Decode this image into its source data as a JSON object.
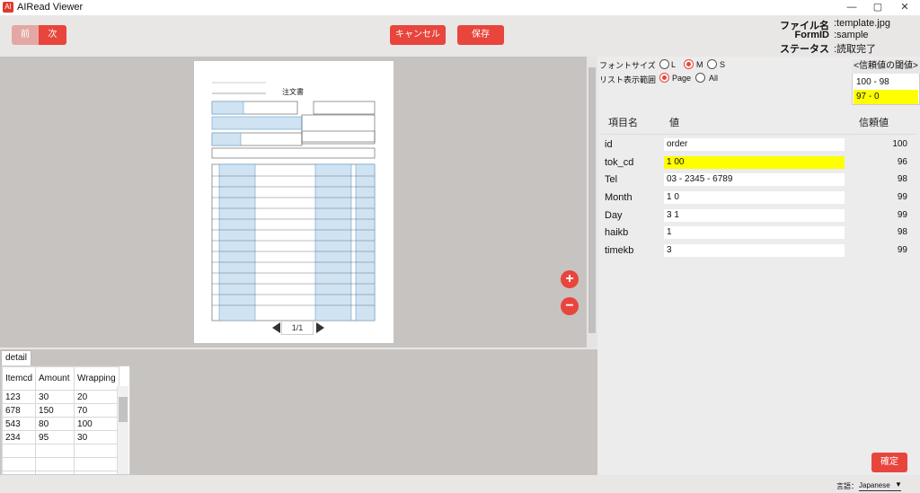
{
  "window": {
    "title": "AIRead Viewer",
    "min": "—",
    "max": "▢",
    "close": "✕"
  },
  "toolbar": {
    "prev": "前",
    "next": "次",
    "cancel": "キャンセル",
    "save": "保存"
  },
  "meta": [
    {
      "label": "ファイル名",
      "value": ":template.jpg"
    },
    {
      "label": "FormID",
      "value": ":sample"
    },
    {
      "label": "ステータス",
      "value": ":読取完了"
    }
  ],
  "document": {
    "title": "注文書"
  },
  "pager": {
    "page": "1/1"
  },
  "zoom": {
    "in": "+",
    "out": "−"
  },
  "detail": {
    "tab": "detail",
    "columns": [
      "Itemcd",
      "Amount",
      "Wrapping"
    ],
    "rows": [
      [
        "123",
        "30",
        "20"
      ],
      [
        "678",
        "150",
        "70"
      ],
      [
        "543",
        "80",
        "100"
      ],
      [
        "234",
        "95",
        "30"
      ],
      [
        "",
        "",
        ""
      ],
      [
        "",
        "",
        ""
      ],
      [
        "",
        "",
        ""
      ]
    ]
  },
  "settings": {
    "font_size_label": "フォントサイズ",
    "font_opts": [
      "L",
      "M",
      "S"
    ],
    "font_selected": "M",
    "range_label": "リスト表示範囲",
    "range_opts": [
      "Page",
      "All"
    ],
    "range_selected": "Page"
  },
  "confidence": {
    "header": "<信頼値の閾値>",
    "ranges": [
      "100 - 98",
      "97 - 0"
    ],
    "highlight_color": "#ffff00"
  },
  "fields": {
    "col_name": "項目名",
    "col_value": "値",
    "col_conf": "信頼値",
    "rows": [
      {
        "name": "id",
        "value": "order",
        "conf": "100",
        "hl": false
      },
      {
        "name": "tok_cd",
        "value": "1 00",
        "conf": "96",
        "hl": true
      },
      {
        "name": "Tel",
        "value": "03 - 2345 - 6789",
        "conf": "98",
        "hl": false
      },
      {
        "name": "Month",
        "value": "1 0",
        "conf": "99",
        "hl": false
      },
      {
        "name": "Day",
        "value": "3 1",
        "conf": "99",
        "hl": false
      },
      {
        "name": "haikb",
        "value": "1",
        "conf": "98",
        "hl": false
      },
      {
        "name": "timekb",
        "value": "3",
        "conf": "99",
        "hl": false
      }
    ]
  },
  "confirm": "確定",
  "language": {
    "label": "言語：",
    "value": "Japanese"
  },
  "colors": {
    "accent": "#e8453c"
  }
}
